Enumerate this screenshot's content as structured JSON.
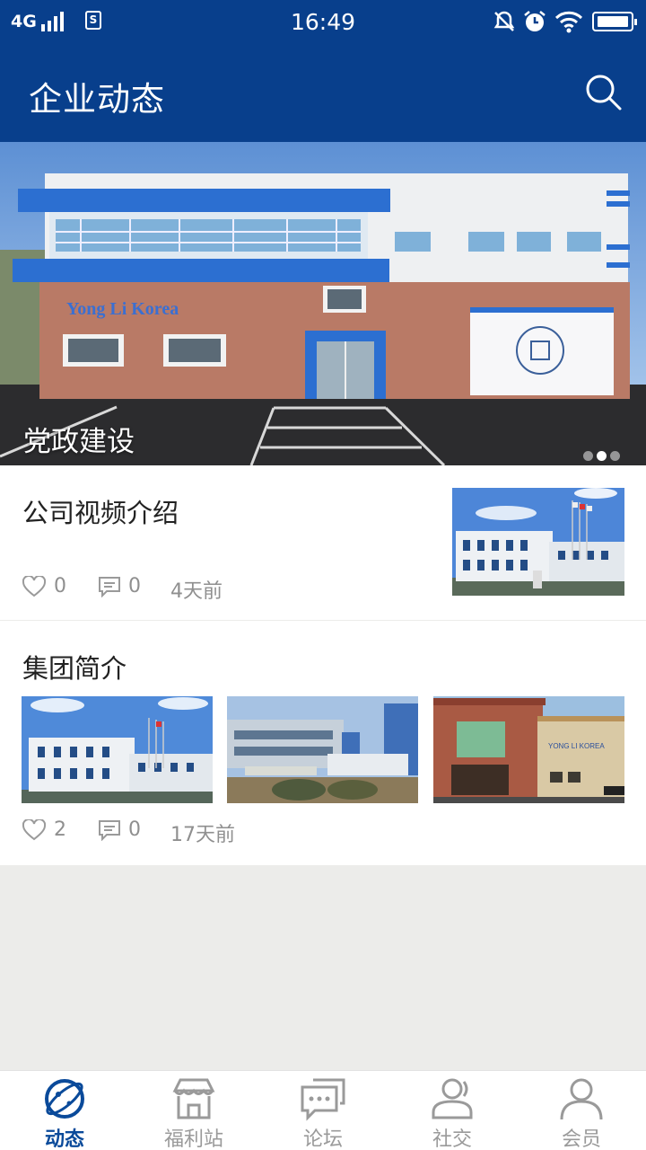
{
  "status_bar": {
    "network": "4G",
    "time": "16:49"
  },
  "header": {
    "title": "企业动态"
  },
  "banner": {
    "caption": "党政建设",
    "sign_text": "Yong Li Korea",
    "page_count": 3,
    "active_page": 2
  },
  "posts": [
    {
      "title": "公司视频介绍",
      "likes": "0",
      "comments": "0",
      "time": "4天前"
    },
    {
      "title": "集团简介",
      "likes": "2",
      "comments": "0",
      "time": "17天前"
    }
  ],
  "tabs": [
    {
      "label": "动态",
      "icon": "planet-icon",
      "active": true
    },
    {
      "label": "福利站",
      "icon": "shop-icon",
      "active": false
    },
    {
      "label": "论坛",
      "icon": "chat-icon",
      "active": false
    },
    {
      "label": "社交",
      "icon": "contacts-icon",
      "active": false
    },
    {
      "label": "会员",
      "icon": "user-icon",
      "active": false
    }
  ],
  "colors": {
    "primary": "#083f8c",
    "tab_active": "#0a4a9a",
    "meta_grey": "#8f8f8f"
  }
}
